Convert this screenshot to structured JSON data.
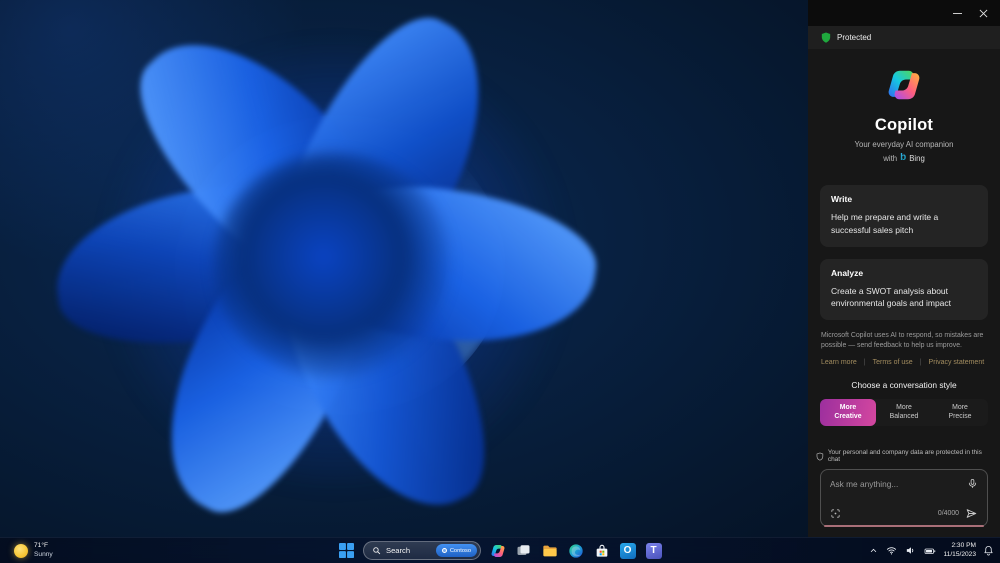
{
  "theme": {
    "accent-green": "#1fa83d",
    "link-color": "#a28c5f",
    "style-grad-1": "#9c2f9e",
    "style-grad-2": "#d4479f",
    "composer-accent": "#a96f78",
    "badge-blue-1": "#4291f2",
    "badge-blue-2": "#1f61c4",
    "panel-bg": "#171717",
    "card-bg": "#242424"
  },
  "sidebar": {
    "protected_label": "Protected",
    "brand": {
      "title": "Copilot",
      "subtitle": "Your everyday AI companion",
      "with_label": "with",
      "bing_label": "Bing"
    },
    "cards": [
      {
        "title": "Write",
        "body": "Help me prepare and write a successful sales pitch"
      },
      {
        "title": "Analyze",
        "body": "Create a SWOT analysis about environmental goals and impact"
      }
    ],
    "disclaimer": "Microsoft Copilot uses AI to respond, so mistakes are possible — send feedback to help us improve.",
    "links": [
      "Learn more",
      "Terms of use",
      "Privacy statement"
    ],
    "style_chooser": {
      "label": "Choose a conversation style",
      "options": [
        {
          "label": "More Creative",
          "selected": true
        },
        {
          "label": "More Balanced",
          "selected": false
        },
        {
          "label": "More Precise",
          "selected": false
        }
      ]
    },
    "privacy_note": "Your personal and company data are protected in this chat",
    "composer": {
      "placeholder": "Ask me anything...",
      "counter": "0/4000"
    }
  },
  "taskbar": {
    "weather": {
      "temp": "71°F",
      "condition": "Sunny"
    },
    "search": {
      "label": "Search",
      "badge": "Contoso"
    },
    "app_icons": [
      "start",
      "copilot",
      "task-view",
      "file-explorer",
      "edge",
      "store",
      "outlook",
      "teams"
    ],
    "tray": {
      "time": "2:30 PM",
      "date": "11/15/2023"
    }
  }
}
